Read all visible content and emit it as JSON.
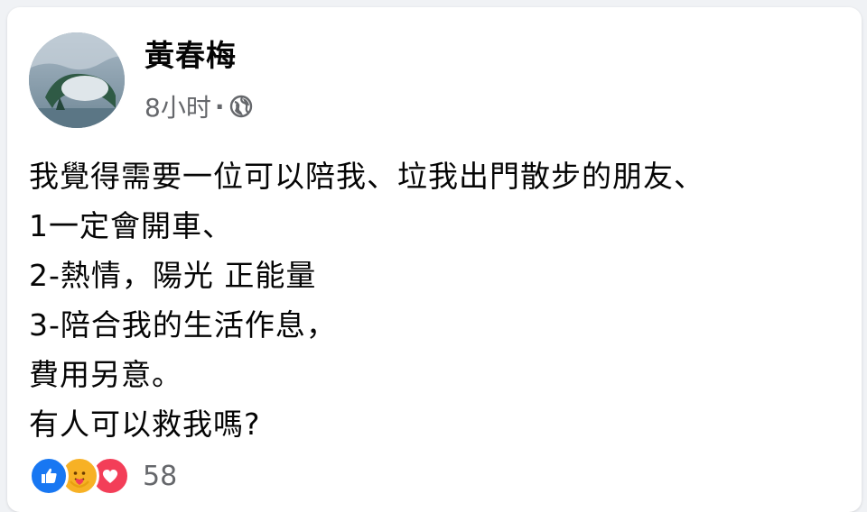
{
  "post": {
    "author": "黃春梅",
    "time": "8小时",
    "separator": "·",
    "privacy_icon": "globe-icon",
    "lines": [
      "我覺得需要一位可以陪我、垃我出門散步的朋友、",
      "1一定會開車、",
      "2-熱情，陽光 正能量",
      "3-陪合我的生活作息，",
      "費用另意。",
      "有人可以救我嗎?"
    ]
  },
  "reactions": {
    "icons": [
      "like-icon",
      "care-icon",
      "love-icon"
    ],
    "count": "58"
  },
  "colors": {
    "like": "#1877f2",
    "care": "#f7b125",
    "love": "#f33e58",
    "secondary_text": "#65676b"
  }
}
